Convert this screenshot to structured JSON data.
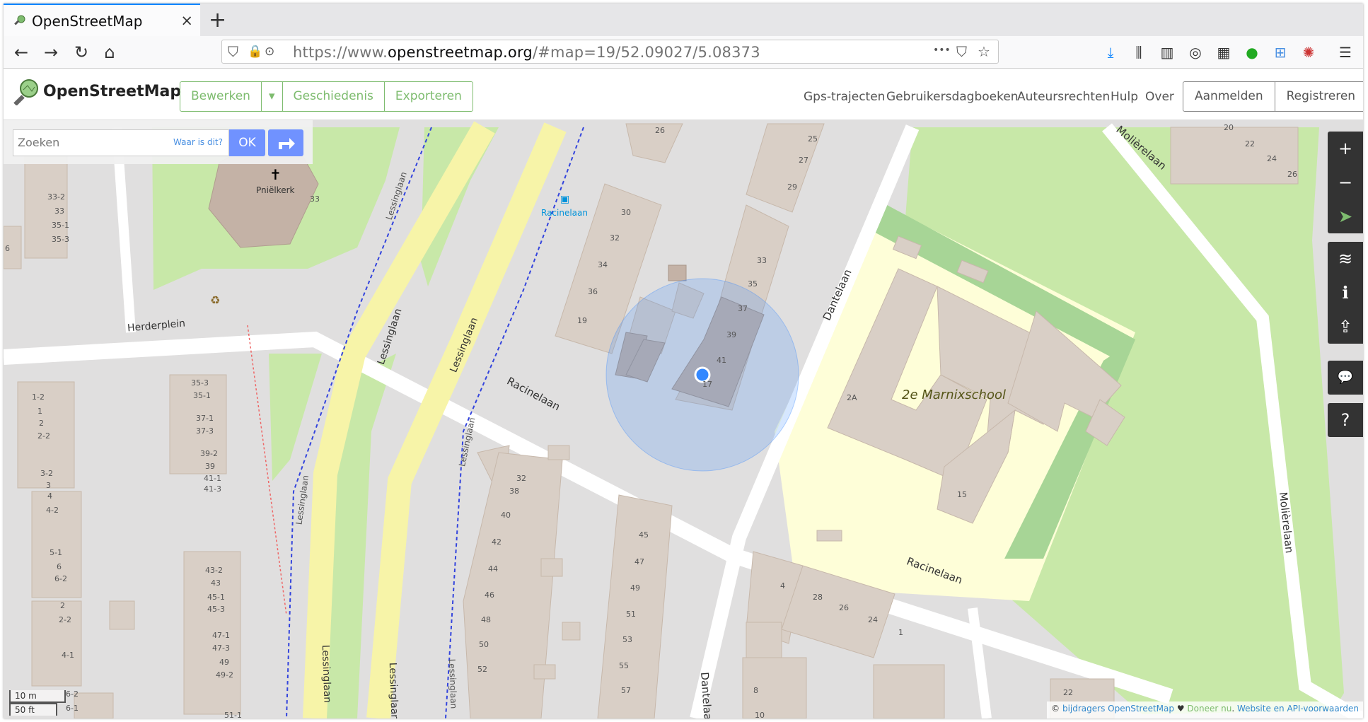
{
  "browser": {
    "tab_title": "OpenStreetMap",
    "tab_close": "×",
    "new_tab": "+",
    "url_prefix": "https://www.",
    "url_domain": "openstreetmap.org",
    "url_suffix": "/#map=19/52.09027/5.08373",
    "url_more": "•••"
  },
  "header": {
    "logo_text": "OpenStreetMap",
    "edit_buttons": [
      "Bewerken",
      "▾",
      "Geschiedenis",
      "Exporteren"
    ],
    "links": [
      "Gps-trajecten",
      "Gebruikersdagboeken",
      "Auteursrechten",
      "Hulp",
      "Over"
    ],
    "auth": [
      "Aanmelden",
      "Registreren"
    ]
  },
  "search": {
    "placeholder": "Zoeken",
    "what_is_here": "Waar is dit?",
    "ok": "OK"
  },
  "map": {
    "poi": {
      "church": "Pniëlkerk",
      "school": "2e Marnixschool",
      "bus_stop": "Racinelaan",
      "church_symbol": "✝"
    },
    "streets": {
      "herderplein": "Herderplein",
      "lessinglaan": "Lessinglaan",
      "lessinglaan2": "Lessinglaan",
      "lessinglaan3": "Lessinglaan",
      "lessinglaan4": "Lessinglaan",
      "lessinglaan5": "Lessinglaan",
      "lessinglaan6": "Lessinglaan",
      "lessinglaan7": "Lessinglaan",
      "lessinglaan8": "Lessinglaan",
      "racinelaan": "Racinelaan",
      "racinelaan2": "Racinelaan",
      "dantelaan": "Dantelaan",
      "dantelaan2": "Dantelaan",
      "moliere1": "Molièrelaan",
      "moliere2": "Molièrelaan"
    },
    "housenumbers_left": [
      "33-2",
      "33",
      "35-1",
      "35-3",
      "1-2",
      "1",
      "2",
      "2-2",
      "3-2",
      "3",
      "4",
      "4-2",
      "5-1",
      "6",
      "6-2",
      "2",
      "2-2",
      "4-1",
      "35-3",
      "35-1",
      "37-1",
      "37-3",
      "39-2",
      "39",
      "41-1",
      "41-3",
      "43-2",
      "43",
      "45-1",
      "45-3",
      "47-1",
      "47-3",
      "49",
      "49-2",
      "51-1",
      "6-2",
      "6-1",
      "33",
      "6"
    ],
    "housenumbers_mid": [
      "26",
      "25",
      "27",
      "29",
      "30",
      "32",
      "34",
      "36",
      "19",
      "33",
      "35",
      "37",
      "39",
      "41",
      "17",
      "32",
      "38",
      "40",
      "42",
      "44",
      "46",
      "48",
      "50",
      "52",
      "45",
      "47",
      "49",
      "51",
      "53",
      "55",
      "57"
    ],
    "housenumbers_right": [
      "2A",
      "15",
      "4",
      "28",
      "26",
      "24",
      "1",
      "8",
      "10",
      "22",
      "20",
      "22",
      "24",
      "26",
      "4"
    ],
    "scale": {
      "metric": "10 m",
      "imperial": "50 ft"
    },
    "attribution": {
      "c": "©",
      "contributors": "bijdragers OpenStreetMap",
      "heart": "♥",
      "donate": "Doneer nu",
      "terms": "Website en API-voorwaarden"
    }
  },
  "controls": [
    "+",
    "−",
    "➤",
    "≋",
    "ℹ",
    "⇪",
    "💬",
    "?"
  ]
}
